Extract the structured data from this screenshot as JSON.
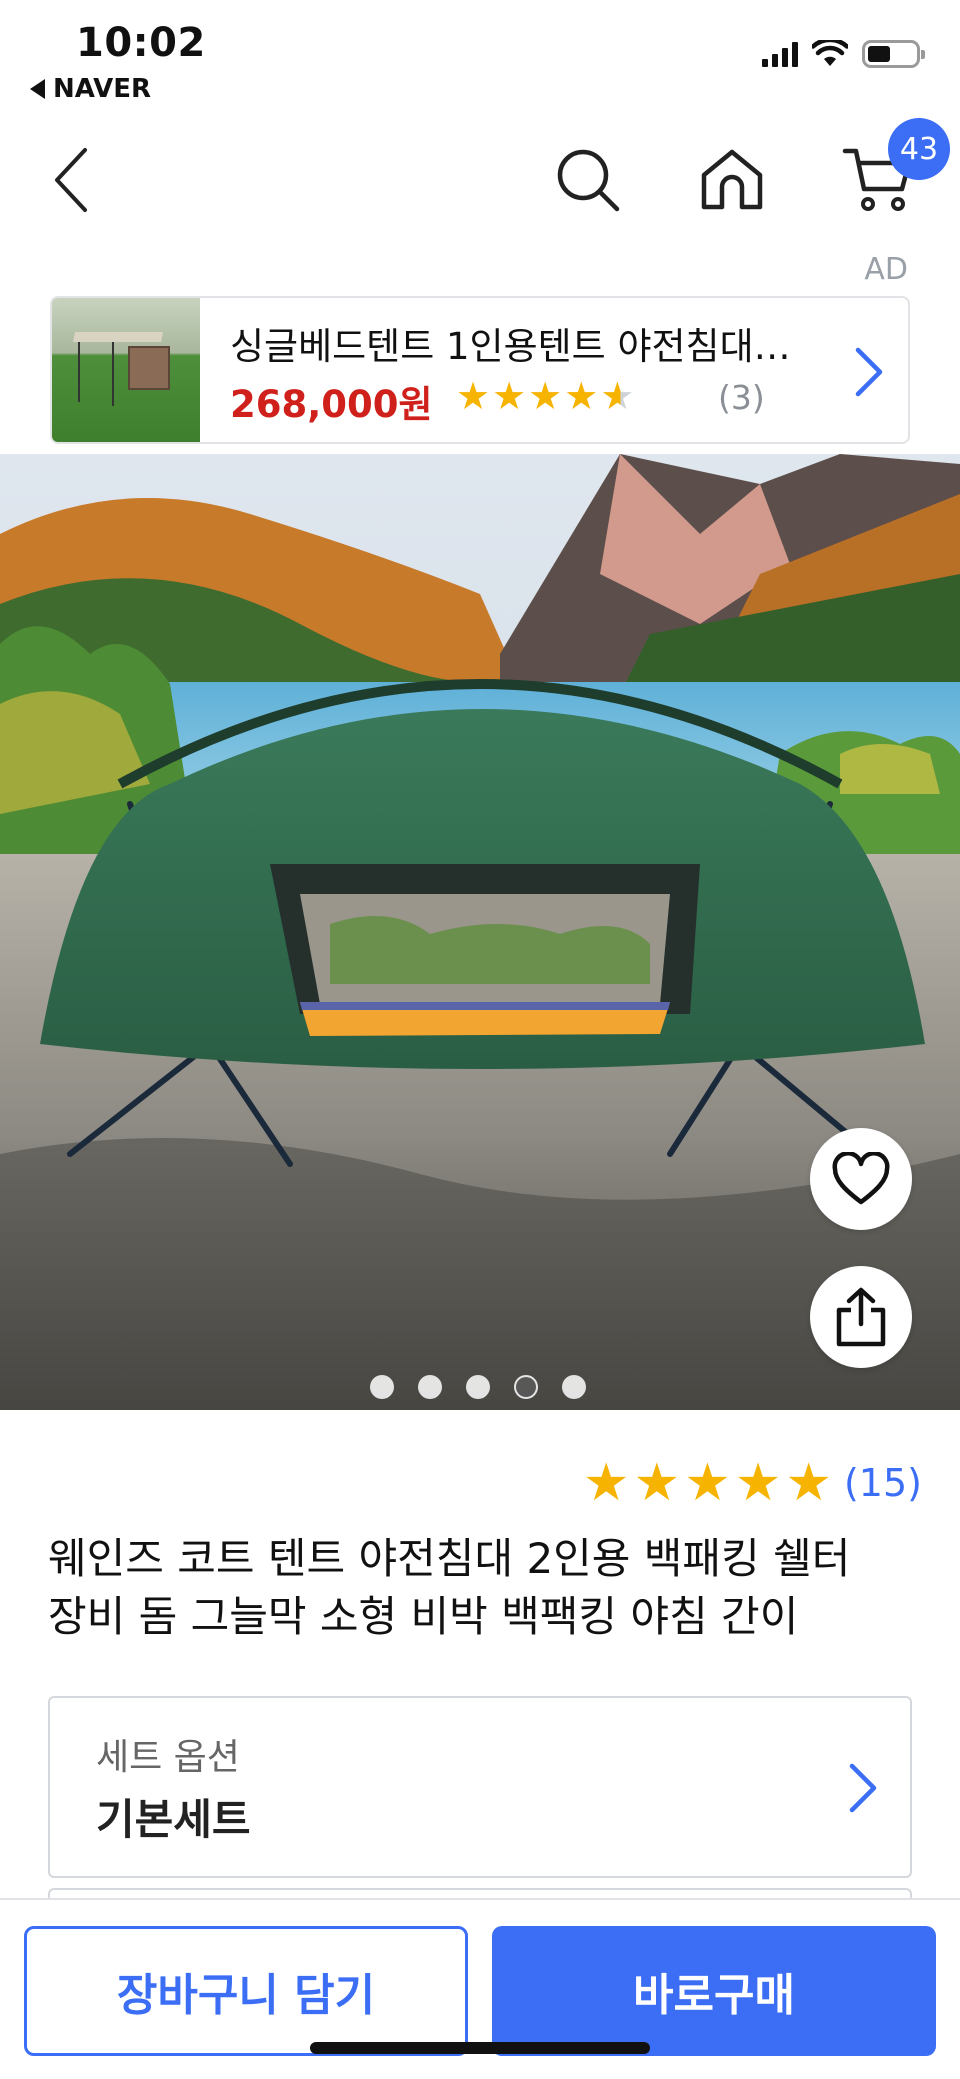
{
  "status_bar": {
    "time": "10:02",
    "back_app": "NAVER"
  },
  "header": {
    "back_icon": "chevron-left-icon",
    "search_icon": "search-icon",
    "home_icon": "home-icon",
    "cart_icon": "cart-icon",
    "cart_count": "43"
  },
  "ad": {
    "label": "AD",
    "title": "싱글베드텐트 1인용텐트 야전침대…",
    "price": "268,000원",
    "rating": 4.5,
    "review_count": "(3)"
  },
  "gallery": {
    "image_count": 5,
    "active_index": 3
  },
  "product": {
    "rating": 5,
    "review_count": "(15)",
    "title_line1": "웨인즈 코트 텐트 야전침대 2인용 백패킹 쉘터",
    "title_line2": "장비 돔 그늘막 소형 비박 백팩킹 야침 간이"
  },
  "option": {
    "label": "세트 옵션",
    "value": "기본세트"
  },
  "actions": {
    "add_to_cart": "장바구니 담기",
    "buy_now": "바로구매"
  },
  "colors": {
    "accent": "#3b6ef5",
    "price_red": "#d0201b",
    "star": "#f6b400"
  }
}
